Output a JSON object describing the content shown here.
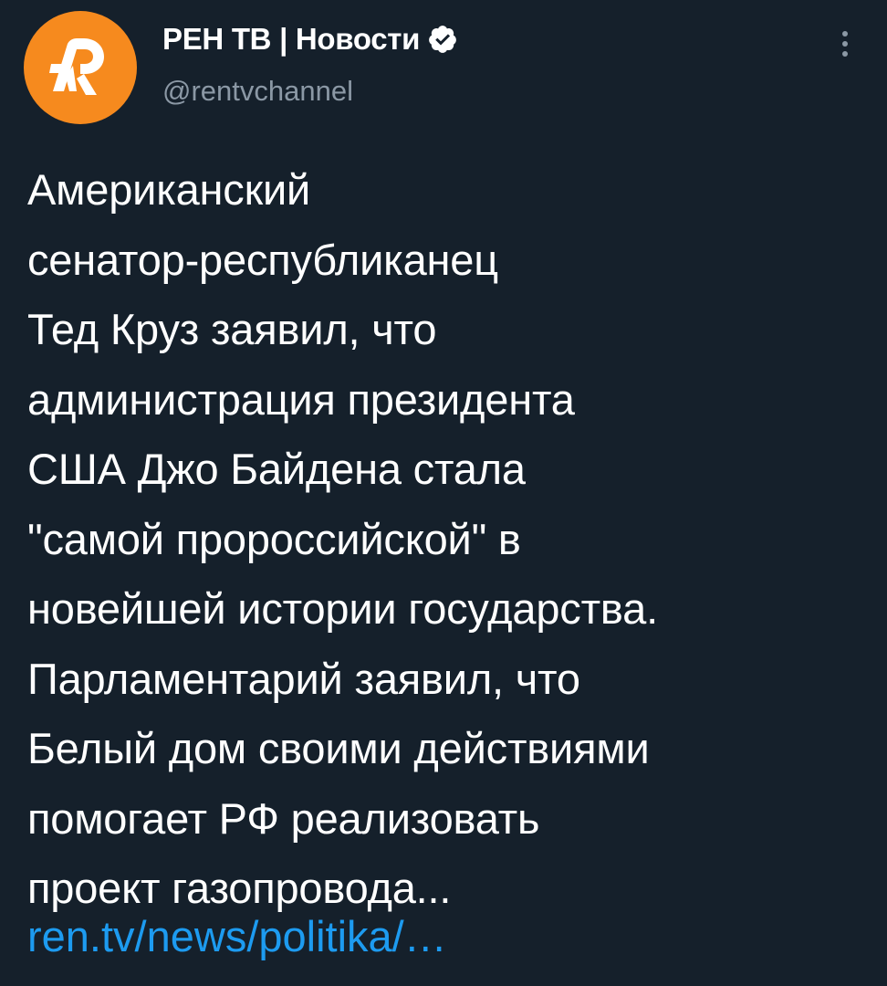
{
  "author": {
    "name": "РЕН ТВ | Новости",
    "handle": "@rentvchannel",
    "verified": true,
    "avatar_icon": "ren-tv-logo-icon",
    "avatar_color": "#f68a1e"
  },
  "menu": {
    "icon": "more-options-icon"
  },
  "tweet": {
    "text": "Американский\nсенатор-республиканец\nТед Круз заявил, что\nадминистрация президента\nСША Джо Байдена стала\n\"самой пророссийской\" в\nновейшей истории государства.\nПарламентарий заявил, что\nБелый дом своими действиями\nпомогает РФ реализовать\nпроект газопровода...",
    "link": "ren.tv/news/politika/…"
  },
  "colors": {
    "background": "#15202b",
    "text": "#ffffff",
    "secondary_text": "#8b98a5",
    "link": "#1d9bf0"
  }
}
